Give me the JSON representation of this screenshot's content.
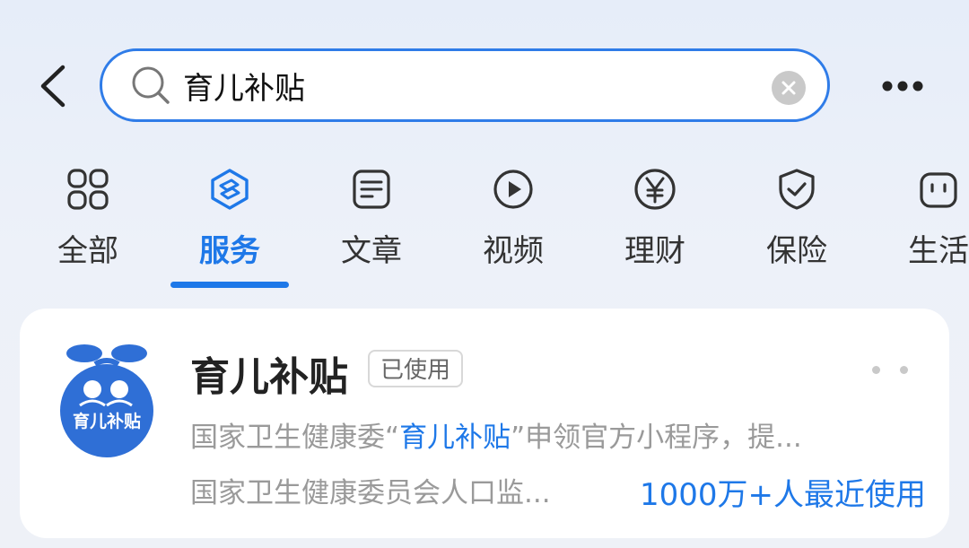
{
  "search": {
    "query": "育儿补贴"
  },
  "tabs": [
    {
      "label": "全部",
      "icon": "grid-icon"
    },
    {
      "label": "服务",
      "icon": "service-icon",
      "active": true
    },
    {
      "label": "文章",
      "icon": "article-icon"
    },
    {
      "label": "视频",
      "icon": "video-icon"
    },
    {
      "label": "理财",
      "icon": "yuan-icon"
    },
    {
      "label": "保险",
      "icon": "shield-icon"
    },
    {
      "label": "生活",
      "icon": "life-icon"
    }
  ],
  "result": {
    "name": "育儿补贴",
    "badge": "已使用",
    "logo_text": "育儿补贴",
    "desc_prefix": "国家卫生健康委“",
    "desc_highlight": "育儿补贴",
    "desc_suffix": "”申领官方小程序，提...",
    "provider": "国家卫生健康委员会人口监...",
    "usage": "1000万+人最近使用"
  },
  "colors": {
    "accent": "#1e78e8",
    "search_border": "#2f7ce8",
    "logo_blue": "#2f6fd6"
  }
}
